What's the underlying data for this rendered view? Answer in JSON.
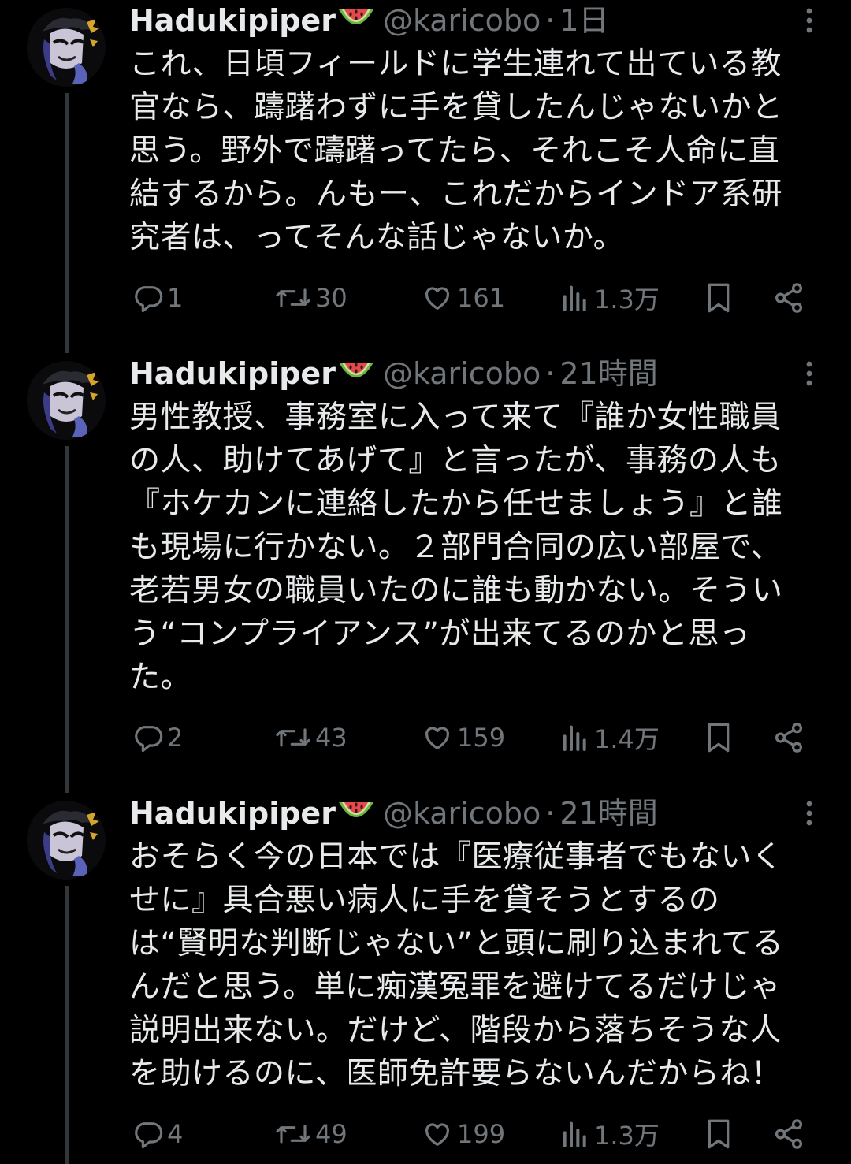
{
  "tweets": [
    {
      "display_name": "Hadukipiper",
      "handle": "@karicobo",
      "separator": "·",
      "time": "1日",
      "text": "これ、日頃フィールドに学生連れて出ている教\n官なら、躊躇わずに手を貸したんじゃないかと\n思う。野外で躊躇ってたら、それこそ人命に直\n結するから。んもー、これだからインドア系研\n究者は、ってそんな話じゃないか。",
      "replies": "1",
      "reposts": "30",
      "likes": "161",
      "views": "1.3万"
    },
    {
      "display_name": "Hadukipiper",
      "handle": "@karicobo",
      "separator": "·",
      "time": "21時間",
      "text": "男性教授、事務室に入って来て『誰か女性職員\nの人、助けてあげて』と言ったが、事務の人も\n『ホケカンに連絡したから任せましょう』と誰\nも現場に行かない。２部門合同の広い部屋で、\n老若男女の職員いたのに誰も動かない。そうい\nう“コンプライアンス”が出来てるのかと思っ\nた。",
      "replies": "2",
      "reposts": "43",
      "likes": "159",
      "views": "1.4万"
    },
    {
      "display_name": "Hadukipiper",
      "handle": "@karicobo",
      "separator": "·",
      "time": "21時間",
      "text": "おそらく今の日本では『医療従事者でもないく\nせに』具合悪い病人に手を貸そうとするの\nは“賢明な判断じゃない”と頭に刷り込まれてる\nんだと思う。単に痴漢冤罪を避けてるだけじゃ\n説明出来ない。だけど、階段から落ちそうな人\nを助けるのに、医師免許要らないんだからね！",
      "replies": "4",
      "reposts": "49",
      "likes": "199",
      "views": "1.3万"
    }
  ],
  "colors": {
    "background": "#000000",
    "primary_text": "#e7e9ea",
    "secondary_text": "#71767b",
    "thread_line": "#333639"
  },
  "icons": [
    "avatar",
    "watermelon-emoji",
    "more-icon",
    "reply-icon",
    "repost-icon",
    "like-icon",
    "views-icon",
    "bookmark-icon",
    "share-icon"
  ]
}
